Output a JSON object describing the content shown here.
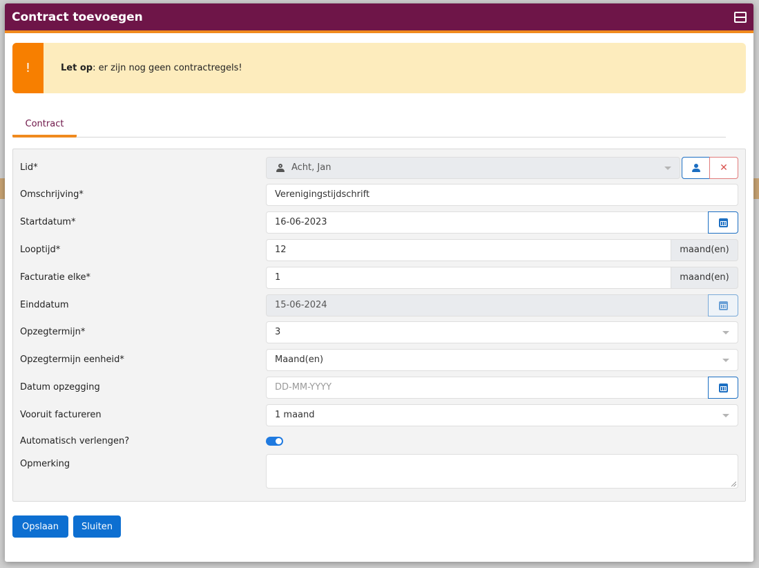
{
  "modal": {
    "title": "Contract toevoegen",
    "header_icon": "window-restore-icon",
    "colors": {
      "header": "#6e1548",
      "accent": "#f08a1e",
      "primary": "#0d6fd1"
    }
  },
  "alert": {
    "icon": "!",
    "bold_text": "Let op",
    "text": ": er zijn nog geen contractregels!"
  },
  "tabs": [
    {
      "label": "Contract",
      "active": true
    }
  ],
  "form": {
    "lid": {
      "label": "Lid*",
      "value": "Acht, Jan"
    },
    "omschrijving": {
      "label": "Omschrijving*",
      "value": "Verenigingstijdschrift"
    },
    "startdatum": {
      "label": "Startdatum*",
      "value": "16-06-2023"
    },
    "looptijd": {
      "label": "Looptijd*",
      "value": "12",
      "unit": "maand(en)"
    },
    "facturatie": {
      "label": "Facturatie elke*",
      "value": "1",
      "unit": "maand(en)"
    },
    "einddatum": {
      "label": "Einddatum",
      "value": "15-06-2024"
    },
    "opzegtermijn": {
      "label": "Opzegtermijn*",
      "value": "3"
    },
    "opzegtermijn_eenheid": {
      "label": "Opzegtermijn eenheid*",
      "value": "Maand(en)"
    },
    "datum_opzegging": {
      "label": "Datum opzegging",
      "placeholder": "DD-MM-YYYY"
    },
    "vooruit_factureren": {
      "label": "Vooruit factureren",
      "value": "1 maand"
    },
    "automatisch_verlengen": {
      "label": "Automatisch verlengen?",
      "checked": true
    },
    "opmerking": {
      "label": "Opmerking",
      "value": ""
    }
  },
  "footer": {
    "save_label": "Opslaan",
    "close_label": "Sluiten"
  }
}
